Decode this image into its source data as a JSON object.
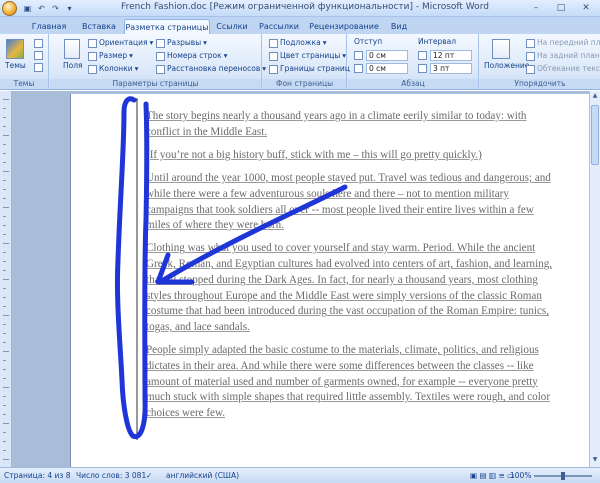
{
  "window": {
    "title": "French Fashion.doc [Режим ограниченной функциональности] - Microsoft Word",
    "minimize_glyph": "–",
    "maximize_glyph": "□",
    "close_glyph": "✕"
  },
  "tabs": [
    "Главная",
    "Вставка",
    "Разметка страницы",
    "Ссылки",
    "Рассылки",
    "Рецензирование",
    "Вид"
  ],
  "active_tab": "Разметка страницы",
  "ribbon": {
    "themes": {
      "themes_button": "Темы",
      "group_label": "Темы"
    },
    "page_setup": {
      "margins_button": "Поля",
      "orientation": "Ориентация",
      "size": "Размер",
      "columns": "Колонки",
      "breaks": "Разрывы",
      "line_numbers": "Номера строк",
      "hyphenation": "Расстановка переносов",
      "group_label": "Параметры страницы"
    },
    "page_background": {
      "watermark": "Подложка",
      "page_color": "Цвет страницы",
      "page_borders": "Границы страниц",
      "group_label": "Фон страницы"
    },
    "paragraph": {
      "indent_header": "Отступ",
      "spacing_header": "Интервал",
      "indent_left": "0 см",
      "indent_right": "0 см",
      "spacing_before": "12 пт",
      "spacing_after": "3 пт",
      "group_label": "Абзац"
    },
    "arrange": {
      "position_button": "Положение",
      "bring_front": "На передний пл",
      "send_back": "На задний план",
      "text_wrap": "Обтекание текс",
      "group_label": "Упорядочить"
    }
  },
  "document": {
    "paragraphs": [
      "The story begins nearly a thousand years ago in a climate eerily similar to today: with conflict in the Middle East.",
      "(If you’re not a big history buff, stick with me – this will go pretty quickly.)",
      "Until around the year 1000, most people stayed put.  Travel was tedious and dangerous; and while there were a few adventurous souls here and there – not to mention military campaigns that took soldiers all over -- most people lived their entire lives within a few miles of where they were born.",
      "Clothing was what you used to cover yourself and stay warm.  Period.  While the ancient Greek, Roman, and Egyptian cultures had evolved into centers of art, fashion, and learning, that all stopped during the Dark Ages.  In fact, for nearly a thousand years, most clothing styles throughout Europe and the Middle East were simply versions of the classic Roman costume that had been introduced during the vast occupation of the Roman Empire:  tunics, togas, and lace sandals.",
      "People simply adapted the basic costume to the materials, climate, politics, and religious dictates in their area.  And while there were some differences between the classes -- like amount of material used and number of garments owned, for example -- everyone pretty much stuck with simple shapes that required little assembly.  Textiles were rough, and color choices were few."
    ]
  },
  "status": {
    "page": "Страница: 4 из 8",
    "words": "Число слов: 3 081",
    "language": "английский (США)",
    "zoom": "100%",
    "zoom_fraction": 0.5
  },
  "annotation": {
    "stroke_color": "#1f35d8"
  }
}
